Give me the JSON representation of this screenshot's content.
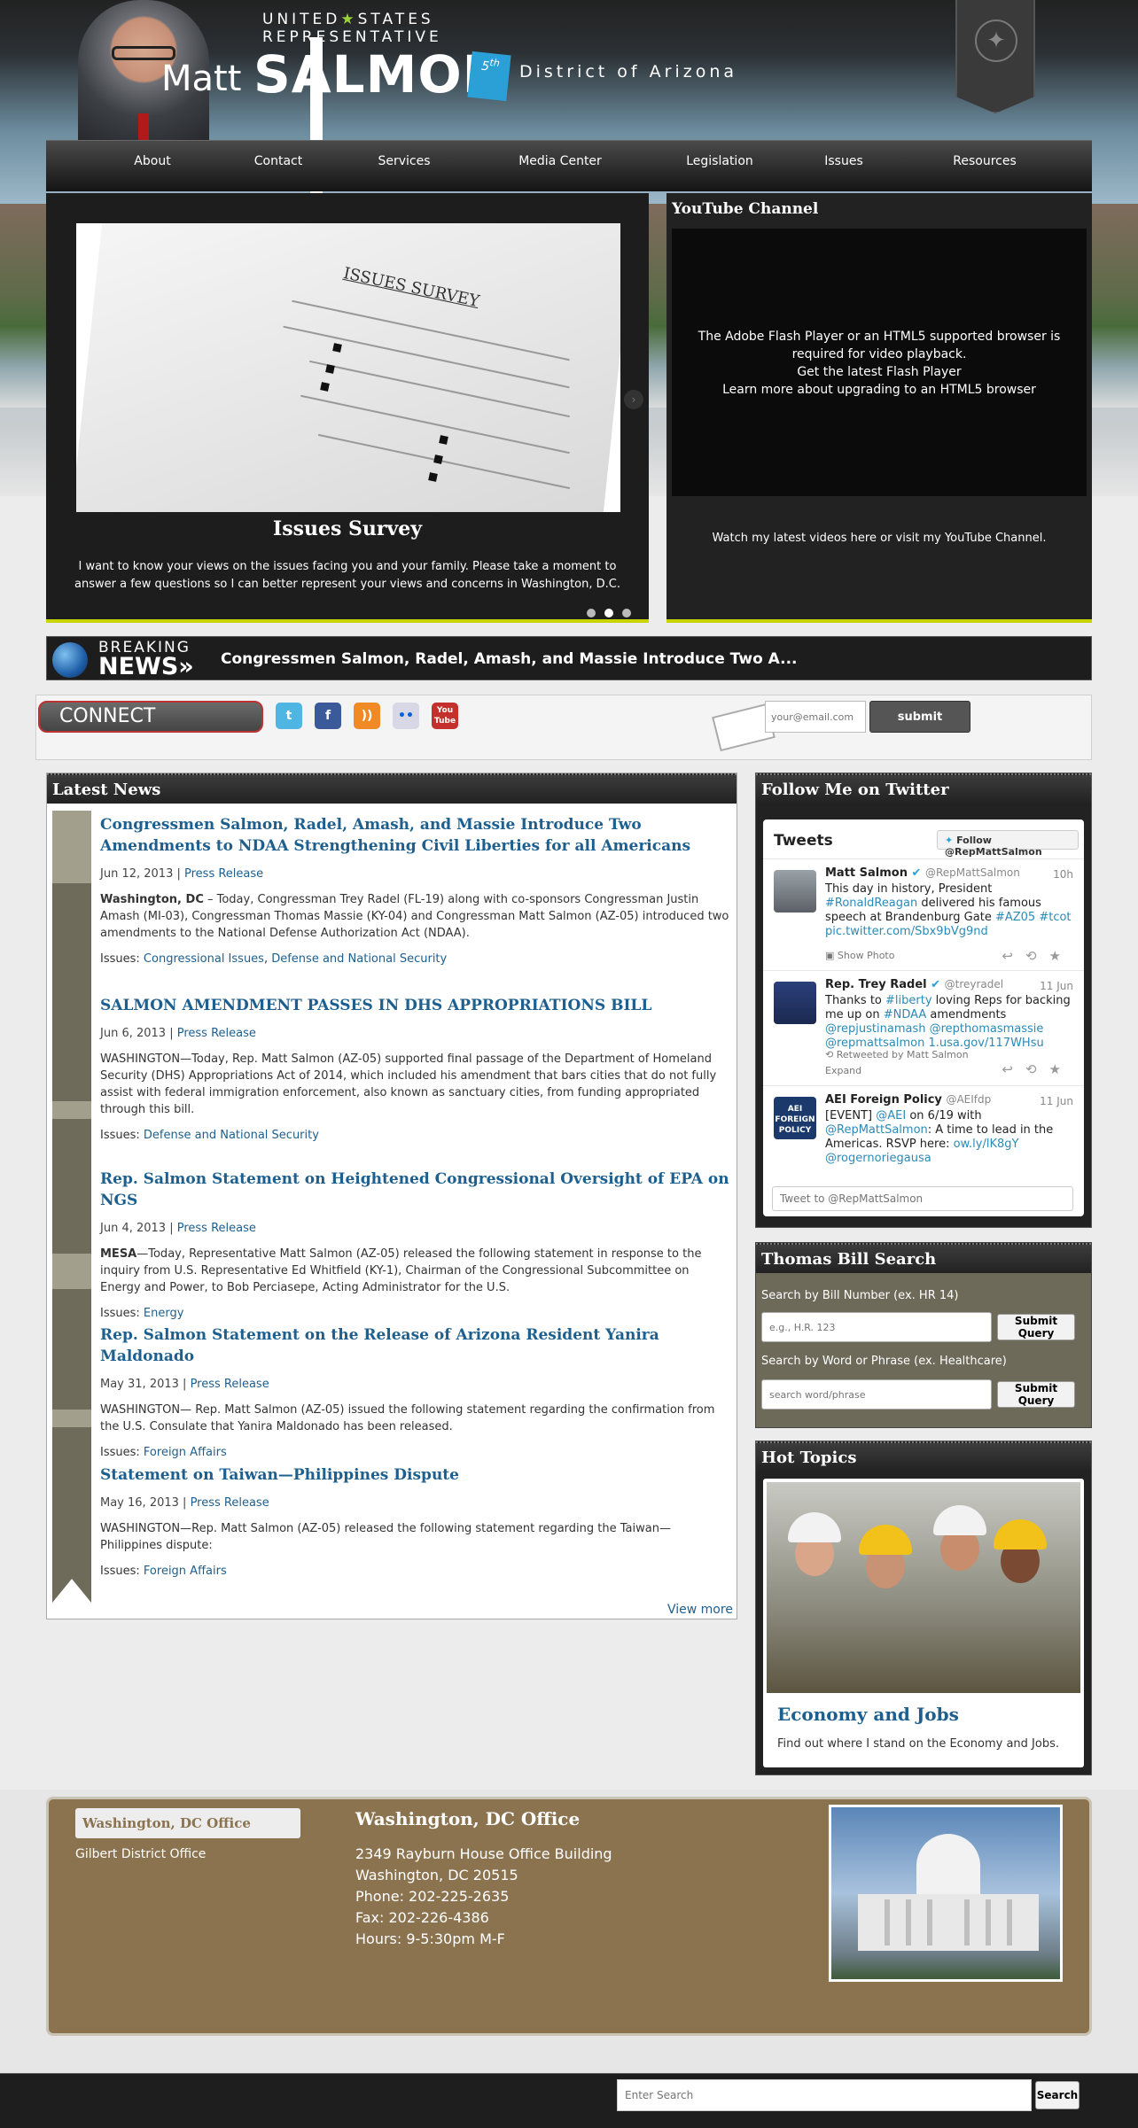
{
  "header": {
    "line1": "UNITED",
    "line1b": "STATES",
    "line2": "REPRESENTATIVE",
    "first_name": "Matt",
    "last_name": "SALMON",
    "district_num": "5",
    "district_suffix": "th",
    "district": "District of Arizona"
  },
  "nav": [
    "About",
    "Contact",
    "Services",
    "Media Center",
    "Legislation",
    "Issues",
    "Resources"
  ],
  "slider": {
    "image_title": "ISSUES SURVEY",
    "title": "Issues Survey",
    "description": "I want to know your views on the issues facing you and your family. Please take a moment to answer a few questions so I can better represent your views and concerns in Washington, D.C."
  },
  "youtube": {
    "title": "YouTube Channel",
    "flash_msg": "The Adobe Flash Player or an HTML5 supported browser is required for video playback.",
    "flash_link": "Get the latest Flash Player",
    "html5_link": "Learn more about upgrading to an HTML5 browser",
    "watch_text": "Watch my latest videos here or visit my",
    "watch_link": "YouTube Channel",
    "watch_end": "."
  },
  "breaking": {
    "label": "BREAKING",
    "label2": "NEWS»",
    "headline": "Congressmen Salmon, Radel, Amash, and Massie Introduce Two A..."
  },
  "connect": {
    "label": "CONNECT",
    "email_placeholder": "your@email.com",
    "submit": "submit"
  },
  "news": {
    "title": "Latest News",
    "issues_label": "Issues:",
    "view_more": "View more",
    "items": [
      {
        "title": "Congressmen Salmon, Radel, Amash, and Massie Introduce Two Amendments to NDAA Strengthening Civil Liberties for all Americans",
        "date": "Jun 12, 2013 |",
        "type": "Press Release",
        "lead": "Washington, DC",
        "body": " – Today, Congressman Trey Radel (FL-19) along with co-sponsors Congressman Justin Amash (MI-03), Congressman Thomas Massie (KY-04) and Congressman Matt Salmon (AZ-05) introduced two amendments to the National Defense Authorization Act (NDAA).",
        "issue1": "Congressional Issues",
        "sep": ", ",
        "issue2": "Defense and National Security"
      },
      {
        "title": "SALMON AMENDMENT PASSES IN DHS APPROPRIATIONS BILL",
        "date": "Jun 6, 2013 |",
        "type": "Press Release",
        "body": "WASHINGTON—Today, Rep. Matt Salmon (AZ-05) supported final passage of the Department of Homeland Security (DHS) Appropriations Act of 2014, which included his amendment that bars cities that do not fully assist with federal immigration enforcement, also known as sanctuary cities, from funding appropriated through this bill.",
        "issue1": "Defense and National Security"
      },
      {
        "title": "Rep. Salmon Statement on Heightened Congressional Oversight of EPA on NGS",
        "date": "Jun 4, 2013 |",
        "type": "Press Release",
        "lead": "MESA",
        "body": "—Today, Representative Matt Salmon (AZ-05) released the following statement in response to the inquiry from U.S. Representative Ed Whitfield (KY-1), Chairman of the Congressional Subcommittee on Energy and Power, to Bob Perciasepe, Acting Administrator for the U.S.",
        "issue1": "Energy"
      },
      {
        "title": "Rep. Salmon Statement on the Release of Arizona Resident Yanira Maldonado",
        "date": "May 31, 2013 |",
        "type": "Press Release",
        "body": "WASHINGTON— Rep. Matt Salmon (AZ-05) issued the following statement regarding the confirmation from the U.S. Consulate that Yanira Maldonado has been released.",
        "issue1": "Foreign Affairs"
      },
      {
        "title": "Statement on Taiwan—Philippines Dispute",
        "date": "May 16, 2013 |",
        "type": "Press Release",
        "body": "WASHINGTON—Rep. Matt Salmon (AZ-05) released the following statement regarding the Taiwan—Philippines dispute:",
        "issue1": "Foreign Affairs"
      }
    ]
  },
  "twitter": {
    "title": "Follow Me on Twitter",
    "tweets_label": "Tweets",
    "follow": "Follow @RepMattSalmon",
    "input_placeholder": "Tweet to @RepMattSalmon",
    "tweets": [
      {
        "name": "Matt Salmon",
        "handle": "@RepMattSalmon",
        "time": "10h",
        "t1": "This day in history, President ",
        "t2": "#RonaldReagan",
        "t3": " delivered his famous speech at Brandenburg Gate ",
        "t4": "#AZ05",
        "t5": "#tcot pic.twitter.com/Sbx9bVg9nd",
        "extra": "Show Photo"
      },
      {
        "name": "Rep. Trey Radel",
        "handle": "@treyradel",
        "time": "11 Jun",
        "t1": "Thanks to ",
        "t2": "#liberty",
        "t3": " loving Reps for backing me up on ",
        "t4": "#NDAA",
        "t5": " amendments ",
        "t6": "@repjustinamash @repthomasmassie @repmattsalmon 1.usa.gov/117WHsu",
        "extra": "Retweeted by Matt Salmon",
        "extra2": "Expand"
      },
      {
        "name": "AEI Foreign Policy",
        "handle": "@AEIfdp",
        "time": "11 Jun",
        "t1": "[EVENT] ",
        "t2": "@AEI",
        "t3": " on 6/19 with ",
        "t4": "@RepMattSalmon",
        "t5": ": A time to lead in the Americas. RSVP here: ",
        "t6": "ow.ly/lK8gY",
        "t7": "@rogernoriegausa"
      }
    ]
  },
  "thomas": {
    "title": "Thomas Bill Search",
    "label1": "Search by Bill Number (ex. HR 14)",
    "placeholder1": "e.g., H.R. 123",
    "label2": "Search by Word or Phrase (ex. Healthcare)",
    "placeholder2": "search word/phrase",
    "submit": "Submit Query"
  },
  "hot_topics": {
    "title": "Hot Topics",
    "card_title": "Economy and Jobs",
    "card_desc": "Find out where I stand on the Economy and Jobs."
  },
  "offices": {
    "tab_active": "Washington, DC Office",
    "tab_other": "Gilbert District Office",
    "title": "Washington, DC Office",
    "lines": [
      "2349 Rayburn House Office Building",
      "Washington, DC 20515",
      "Phone: 202-225-2635",
      "Fax: 202-226-4386",
      "Hours: 9-5:30pm M-F"
    ]
  },
  "footer": {
    "search_placeholder": "Enter Search",
    "search_btn": "Search"
  },
  "colors": {
    "accent_lime": "#c8d400",
    "link_blue": "#1d5f8e",
    "office_brown": "#8b7350"
  }
}
